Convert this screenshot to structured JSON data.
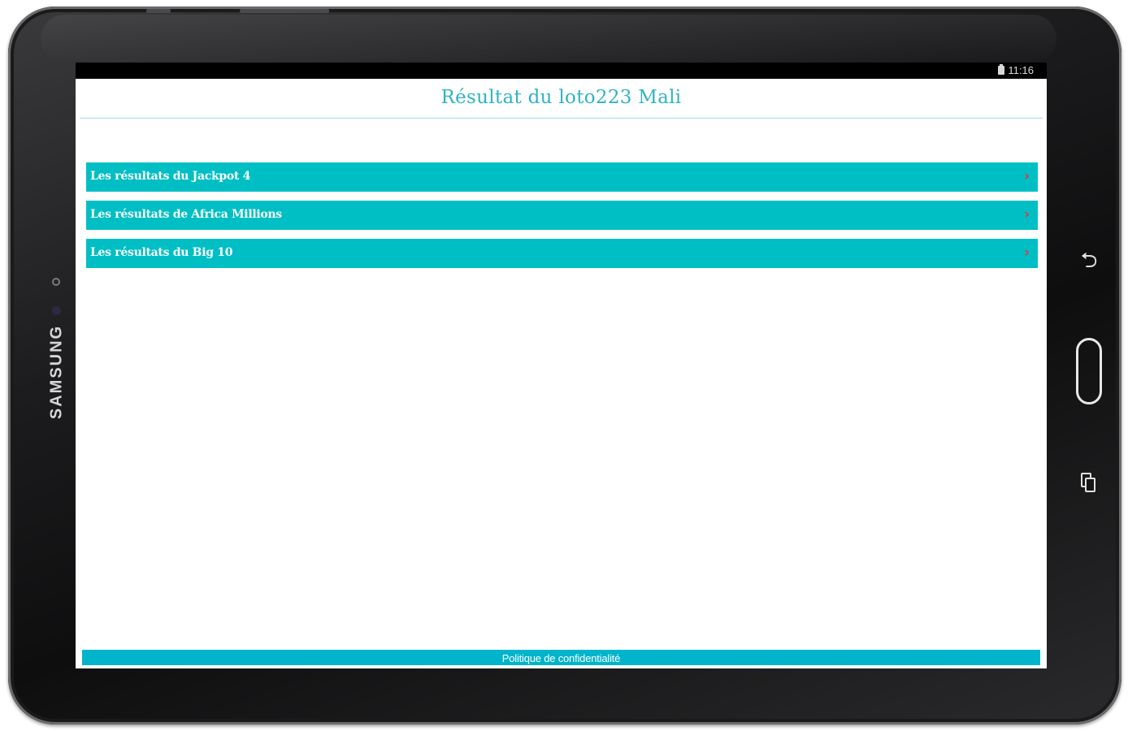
{
  "device": {
    "brand": "SAMSUNG"
  },
  "status_bar": {
    "time": "11:16",
    "icon": "battery-icon"
  },
  "header": {
    "title": "Résultat du loto223 Mali"
  },
  "menu": {
    "items": [
      {
        "label": "Les résultats du Jackpot 4",
        "icon": "chevron-right-icon",
        "chevron": "›"
      },
      {
        "label": "Les résultats de Africa Millions",
        "icon": "chevron-right-icon",
        "chevron": "›"
      },
      {
        "label": "Les résultats du Big 10",
        "icon": "chevron-right-icon",
        "chevron": "›"
      }
    ]
  },
  "footer": {
    "link_label": "Politique de confidentialité"
  },
  "navigation": {
    "back_icon": "back-icon",
    "home_icon": "home-button",
    "recents_icon": "recents-icon",
    "back_glyph": "⮌"
  },
  "colors": {
    "accent": "#00bfc4",
    "title": "#2fb3c5",
    "chevron": "#e8334a",
    "footer": "#00b4cc"
  }
}
